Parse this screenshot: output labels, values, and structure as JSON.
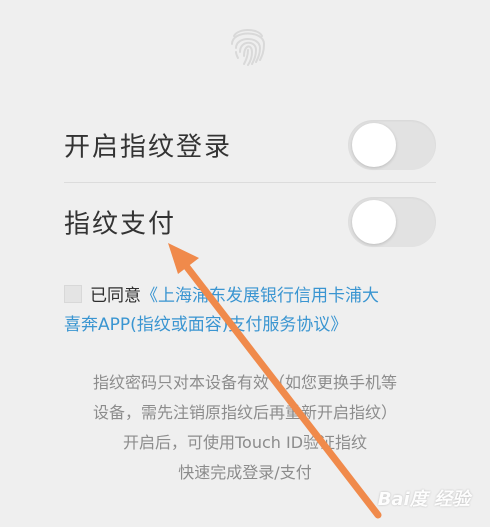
{
  "settings": {
    "fingerprint_login": {
      "label": "开启指纹登录",
      "enabled": false
    },
    "fingerprint_pay": {
      "label": "指纹支付",
      "enabled": false
    }
  },
  "agreement": {
    "prefix": "已同意",
    "link_line1": "《上海浦东发展银行信用卡浦大",
    "link_line2": "喜奔APP(指纹或面容)支付服务协议》",
    "checked": false
  },
  "note": {
    "line1": "指纹密码只对本设备有效（如您更换手机等",
    "line2": "设备，需先注销原指纹后再重新开启指纹）",
    "line3": "开启后，可使用Touch ID验证指纹",
    "line4": "快速完成登录/支付"
  },
  "watermark": {
    "text": "Bai度 经验"
  },
  "colors": {
    "background": "#efefef",
    "link": "#3a95d1",
    "note": "#8c8c8c",
    "arrow": "#f08a4b"
  }
}
